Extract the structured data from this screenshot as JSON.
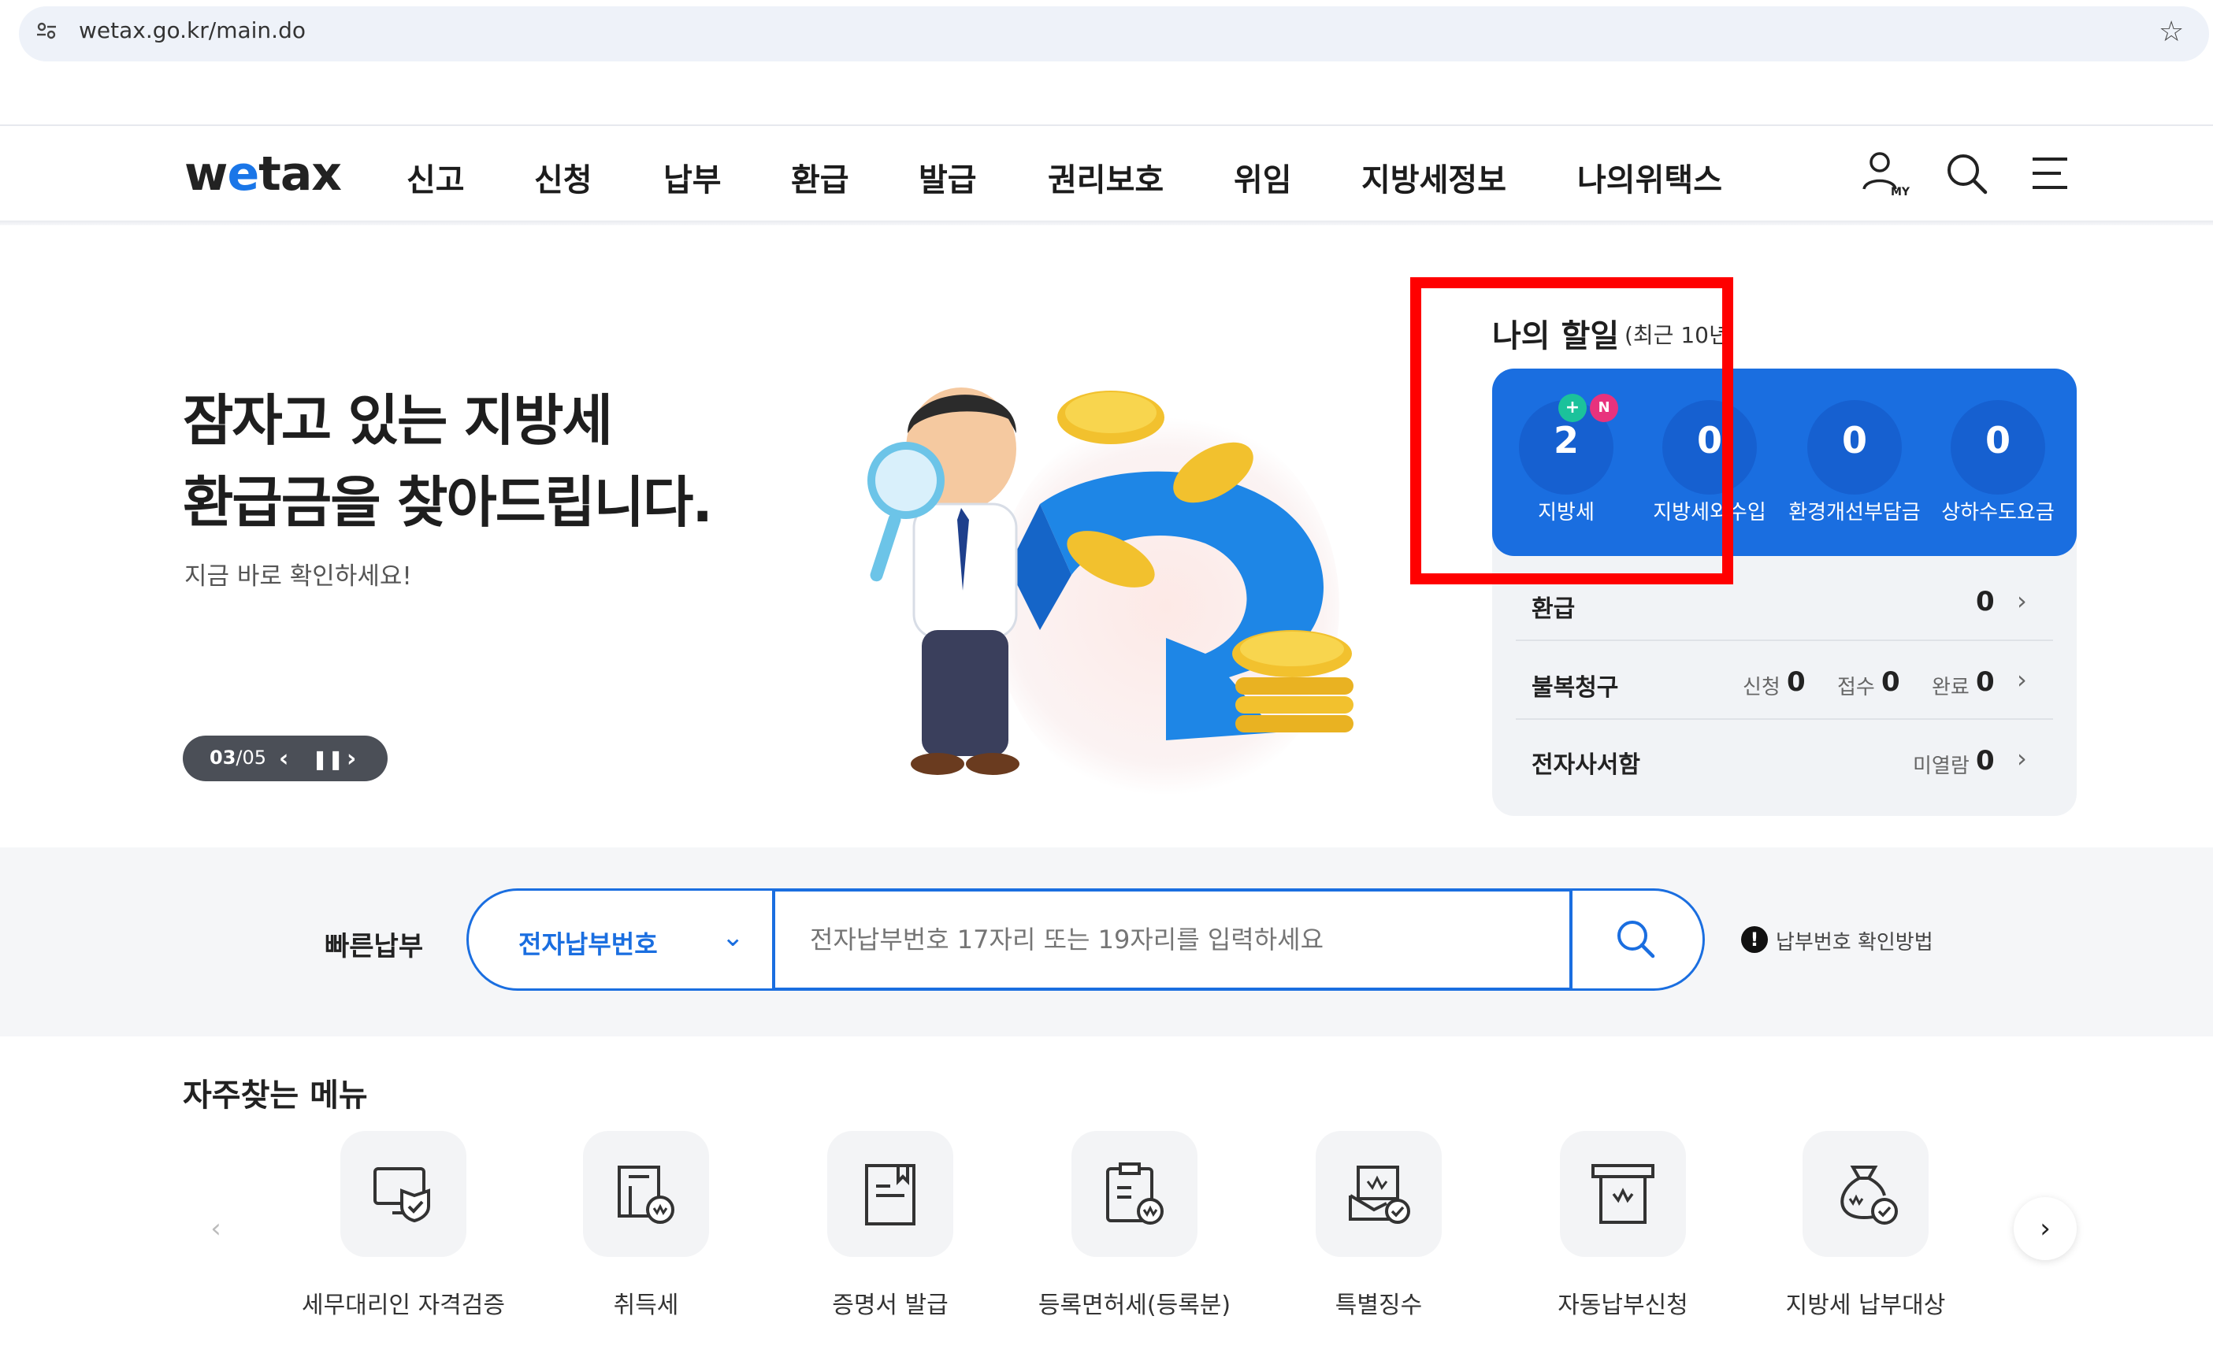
{
  "browser": {
    "url": "wetax.go.kr/main.do"
  },
  "header": {
    "logo": {
      "pre": "w",
      "e": "e",
      "post": "tax"
    },
    "nav": [
      "신고",
      "신청",
      "납부",
      "환급",
      "발급",
      "권리보호",
      "위임",
      "지방세정보",
      "나의위택스"
    ],
    "icons": [
      "my-user-icon",
      "search-icon",
      "menu-icon"
    ],
    "my_label": "MY"
  },
  "hero": {
    "title_line1": "잠자고 있는 지방세",
    "title_line2": "환급금을 찾아드립니다.",
    "subtitle": "지금 바로 확인하세요!",
    "pager": {
      "current": "03",
      "sep": "/",
      "total": "05"
    }
  },
  "todo": {
    "title": "나의 할일",
    "subtitle": "(최근 10년",
    "cards": [
      {
        "value": "2",
        "label": "지방세"
      },
      {
        "value": "0",
        "label": "지방세외수입"
      },
      {
        "value": "0",
        "label": "환경개선부담금"
      },
      {
        "value": "0",
        "label": "상하수도요금"
      }
    ],
    "badges": {
      "plus": "+",
      "new": "N"
    },
    "rows": {
      "refund": {
        "label": "환급",
        "value": "0"
      },
      "appeal": {
        "label": "불복청구",
        "apply_label": "신청",
        "apply": "0",
        "receive_label": "접수",
        "receive": "0",
        "done_label": "완료",
        "done": "0"
      },
      "edoc": {
        "label": "전자사서함",
        "unread_label": "미열람",
        "unread": "0"
      }
    },
    "highlight_color": "#ff0000"
  },
  "quick_pay": {
    "label": "빠른납부",
    "select": "전자납부번호",
    "placeholder": "전자납부번호 17자리 또는 19자리를 입력하세요",
    "help": "납부번호 확인방법"
  },
  "frequent": {
    "title": "자주찾는 메뉴",
    "items": [
      {
        "label": "세무대리인 자격검증",
        "icon": "monitor-shield-icon"
      },
      {
        "label": "취득세",
        "icon": "building-coin-icon"
      },
      {
        "label": "증명서 발급",
        "icon": "document-icon"
      },
      {
        "label": "등록면허세(등록분)",
        "icon": "clipboard-coin-icon"
      },
      {
        "label": "특별징수",
        "icon": "envelope-check-icon"
      },
      {
        "label": "자동납부신청",
        "icon": "printer-icon"
      },
      {
        "label": "지방세 납부대상",
        "icon": "money-bag-icon"
      }
    ]
  },
  "colors": {
    "brand_blue": "#1a6ee0",
    "accent_green": "#1bc29b",
    "accent_pink": "#e8327d"
  }
}
